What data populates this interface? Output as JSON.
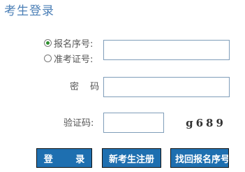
{
  "page": {
    "title": "考生登录"
  },
  "login_type": {
    "options": [
      {
        "label": "报名序号:",
        "selected": true
      },
      {
        "label": "准考证号:",
        "selected": false
      }
    ]
  },
  "username": {
    "value": ""
  },
  "password": {
    "label": "密 码:",
    "value": ""
  },
  "captcha": {
    "label": "验证码:",
    "value": "",
    "image_text": "g689"
  },
  "buttons": {
    "login": "登 录",
    "register": "新考生注册",
    "retrieve": "找回报名序号"
  },
  "colors": {
    "title": "#4b7fb6",
    "button_bg": "#1e6fb0",
    "button_text": "#ffffff",
    "input_border": "#7f9db9",
    "radio_checked": "#2f8f2f"
  },
  "icons": {
    "radio_checked": "radio-checked-icon",
    "radio_unchecked": "radio-unchecked-icon"
  }
}
